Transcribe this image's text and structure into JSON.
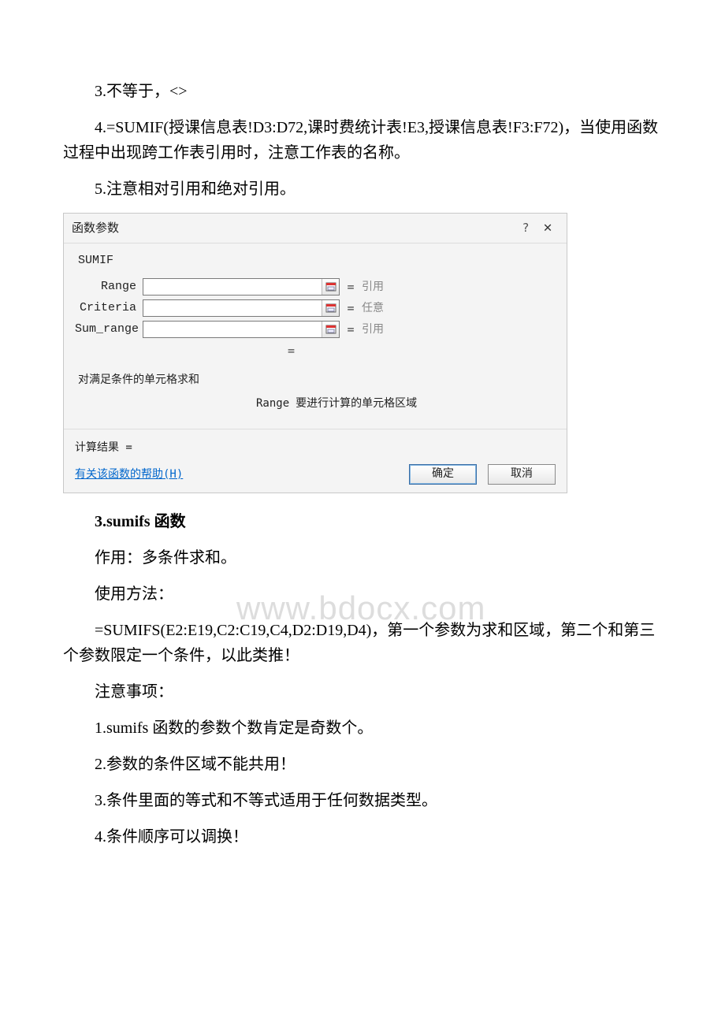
{
  "paragraphs": {
    "p1": "3.不等于，<>",
    "p2": "4.=SUMIF(授课信息表!D3:D72,课时费统计表!E3,授课信息表!F3:F72)，当使用函数过程中出现跨工作表引用时，注意工作表的名称。",
    "p3": "5.注意相对引用和绝对引用。",
    "h1": "3.sumifs 函数",
    "p4": "作用：多条件求和。",
    "p5": "使用方法：",
    "p6": " =SUMIFS(E2:E19,C2:C19,C4,D2:D19,D4)，第一个参数为求和区域，第二个和第三个参数限定一个条件，以此类推！",
    "p7": "注意事项：",
    "p8": "1.sumifs 函数的参数个数肯定是奇数个。",
    "p9": "2.参数的条件区域不能共用！",
    "p10": "3.条件里面的等式和不等式适用于任何数据类型。",
    "p11": "4.条件顺序可以调换！"
  },
  "watermark": "www.bdocx.com",
  "dialog": {
    "title": "函数参数",
    "help_icon": "?",
    "close_icon": "✕",
    "func_name": "SUMIF",
    "params": [
      {
        "label": "Range",
        "value": "",
        "hint": "引用"
      },
      {
        "label": "Criteria",
        "value": "",
        "hint": "任意"
      },
      {
        "label": "Sum_range",
        "value": "",
        "hint": "引用"
      }
    ],
    "eq": "=",
    "description": "对满足条件的单元格求和",
    "range_desc_key": "Range",
    "range_desc_val": "要进行计算的单元格区域",
    "result_label": "计算结果 =",
    "help_link": "有关该函数的帮助(H)",
    "ok": "确定",
    "cancel": "取消"
  }
}
